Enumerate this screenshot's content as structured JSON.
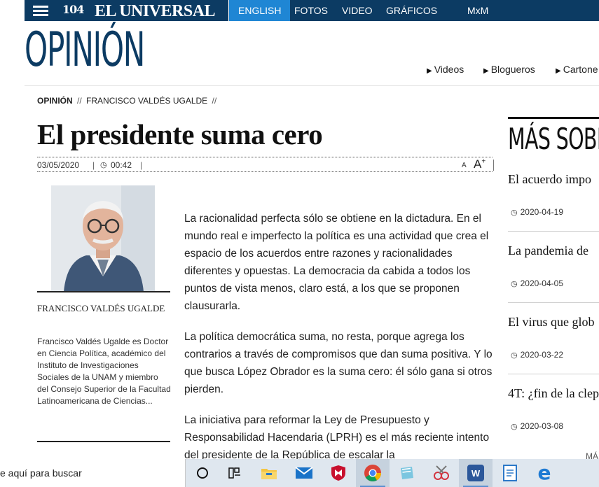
{
  "header": {
    "logo_seal": "104",
    "logo_text": "EL UNIVERSAL",
    "nav": [
      "ENGLISH",
      "FOTOS",
      "VIDEO",
      "GRÁFICOS",
      "MxM"
    ]
  },
  "section": {
    "title": "OPINIÓN",
    "subnav": [
      "Videos",
      "Blogueros",
      "Cartone"
    ]
  },
  "breadcrumb": {
    "items": [
      "OPINIÓN",
      "FRANCISCO VALDÉS UGALDE"
    ],
    "separator": "//"
  },
  "article": {
    "headline": "El presidente suma cero",
    "date": "03/05/2020",
    "time": "00:42",
    "font_small": "A",
    "font_large": "A",
    "font_large_plus": "+",
    "paragraphs": [
      "La racionalidad perfecta sólo se obtiene en la dictadura. En el mundo real e imperfecto la política es una actividad que crea el espacio de los acuerdos entre razones y racionalidades diferentes y opuestas. La democracia da cabida a todos los puntos de vista menos, claro está, a los que se proponen clausurarla.",
      "La política democrática suma, no resta, porque agrega los contrarios a través de compromisos que dan suma positiva. Y lo que busca López Obrador es la suma cero: él sólo gana si otros pierden.",
      "La iniciativa para reformar la Ley de Presupuesto y Responsabilidad Hacendaria (LPRH) es el más reciente intento del presidente de la República de escalar la"
    ]
  },
  "author": {
    "name": "FRANCISCO VALDÉS UGALDE",
    "bio": "Francisco Valdés Ugalde es Doctor en Ciencia Política, académico del Instituto de Investigaciones Sociales de la UNAM y miembro del Consejo Superior de la Facultad Latinoamericana de Ciencias..."
  },
  "sidebar": {
    "title": "MÁS SOBRE",
    "items": [
      {
        "title": "El acuerdo impo",
        "date": "2020-04-19"
      },
      {
        "title": "La pandemia de",
        "date": "2020-04-05"
      },
      {
        "title": "El virus que glob",
        "date": "2020-03-22"
      },
      {
        "title": "4T: ¿fin de la clep",
        "date": "2020-03-08"
      }
    ],
    "more": "MÁ"
  },
  "taskbar": {
    "search_placeholder": "e aquí para buscar",
    "word_label": "W",
    "edge_label": "e"
  },
  "colors": {
    "brand_navy": "#0c3b63",
    "nav_active": "#1f86d4"
  }
}
